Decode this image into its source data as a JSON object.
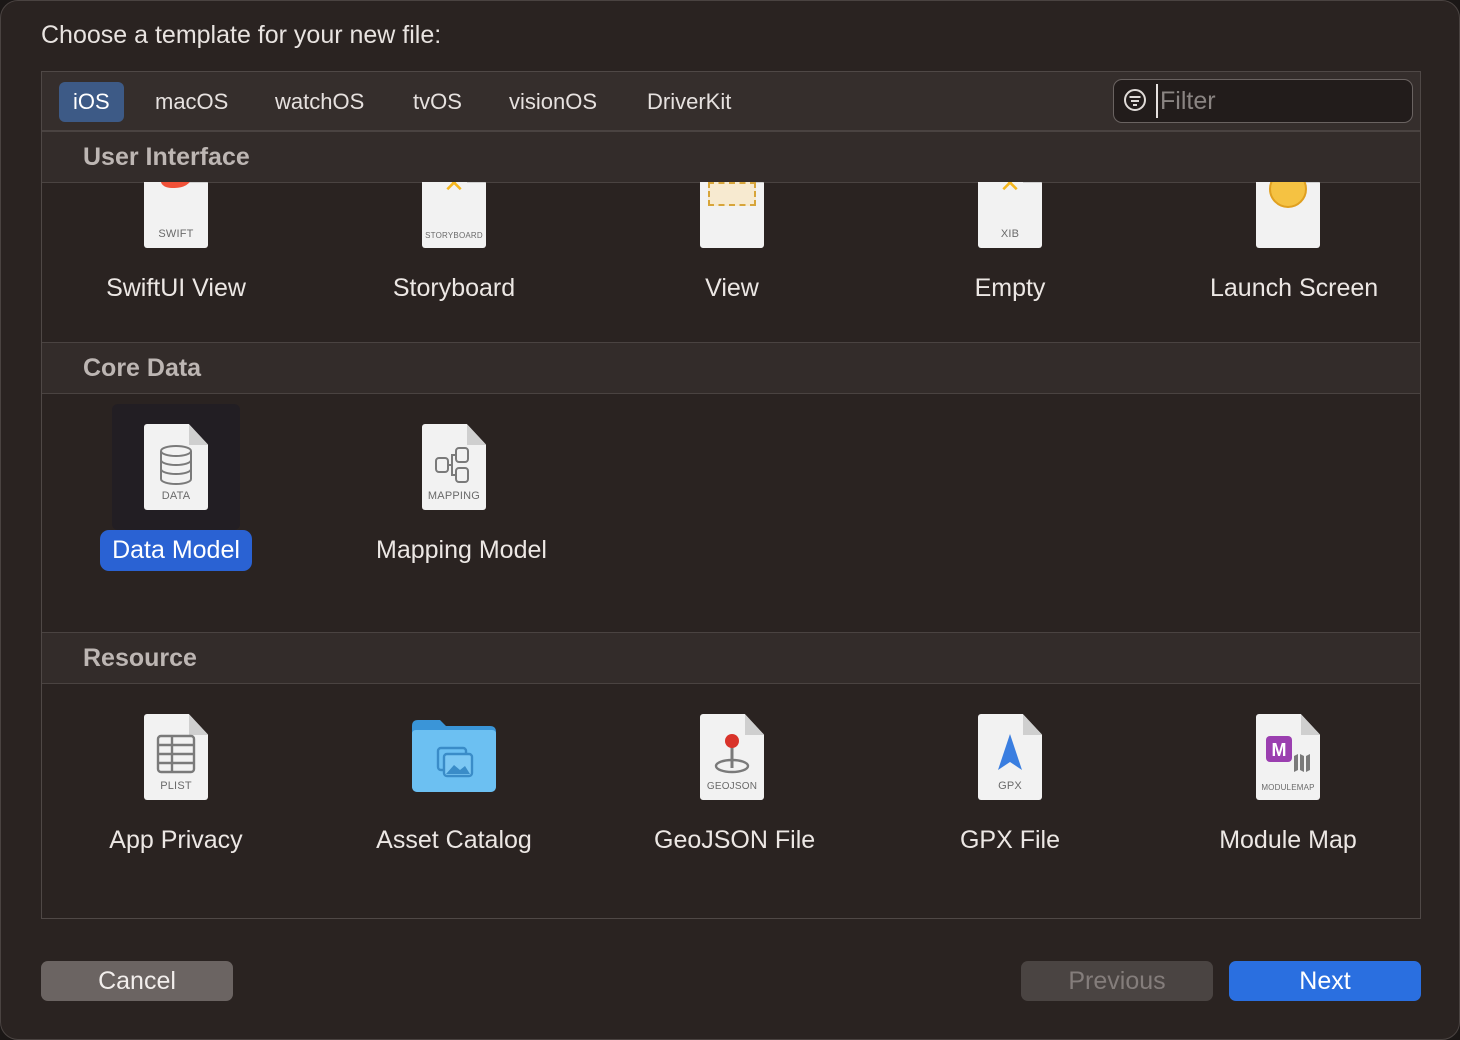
{
  "dialog": {
    "title": "Choose a template for your new file:"
  },
  "tabs": [
    "iOS",
    "macOS",
    "watchOS",
    "tvOS",
    "visionOS",
    "DriverKit"
  ],
  "active_tab": "iOS",
  "filter": {
    "placeholder": "Filter",
    "value": ""
  },
  "sections": {
    "user_interface": {
      "title": "User Interface",
      "items": [
        {
          "label": "SwiftUI View",
          "icon": "swift-file-icon",
          "caption": "SWIFT"
        },
        {
          "label": "Storyboard",
          "icon": "storyboard-file-icon",
          "caption": "STORYBOARD"
        },
        {
          "label": "View",
          "icon": "view-file-icon",
          "caption": ""
        },
        {
          "label": "Empty",
          "icon": "xib-file-icon",
          "caption": "XIB"
        },
        {
          "label": "Launch Screen",
          "icon": "launch-screen-file-icon",
          "caption": ""
        }
      ]
    },
    "core_data": {
      "title": "Core Data",
      "items": [
        {
          "label": "Data Model",
          "icon": "data-model-file-icon",
          "caption": "DATA",
          "selected": true
        },
        {
          "label": "Mapping Model",
          "icon": "mapping-model-file-icon",
          "caption": "MAPPING"
        }
      ]
    },
    "resource": {
      "title": "Resource",
      "items": [
        {
          "label": "App Privacy",
          "icon": "plist-file-icon",
          "caption": "PLIST"
        },
        {
          "label": "Asset Catalog",
          "icon": "asset-folder-icon",
          "caption": ""
        },
        {
          "label": "GeoJSON File",
          "icon": "geojson-file-icon",
          "caption": "GEOJSON"
        },
        {
          "label": "GPX File",
          "icon": "gpx-file-icon",
          "caption": "GPX"
        },
        {
          "label": "Module Map",
          "icon": "modulemap-file-icon",
          "caption": "MODULEMAP"
        }
      ]
    }
  },
  "buttons": {
    "cancel": "Cancel",
    "previous": "Previous",
    "next": "Next"
  },
  "colors": {
    "accent": "#2a62d3",
    "next_button": "#2a6fe0",
    "active_tab": "#3d5a86",
    "background": "#2a2321"
  }
}
